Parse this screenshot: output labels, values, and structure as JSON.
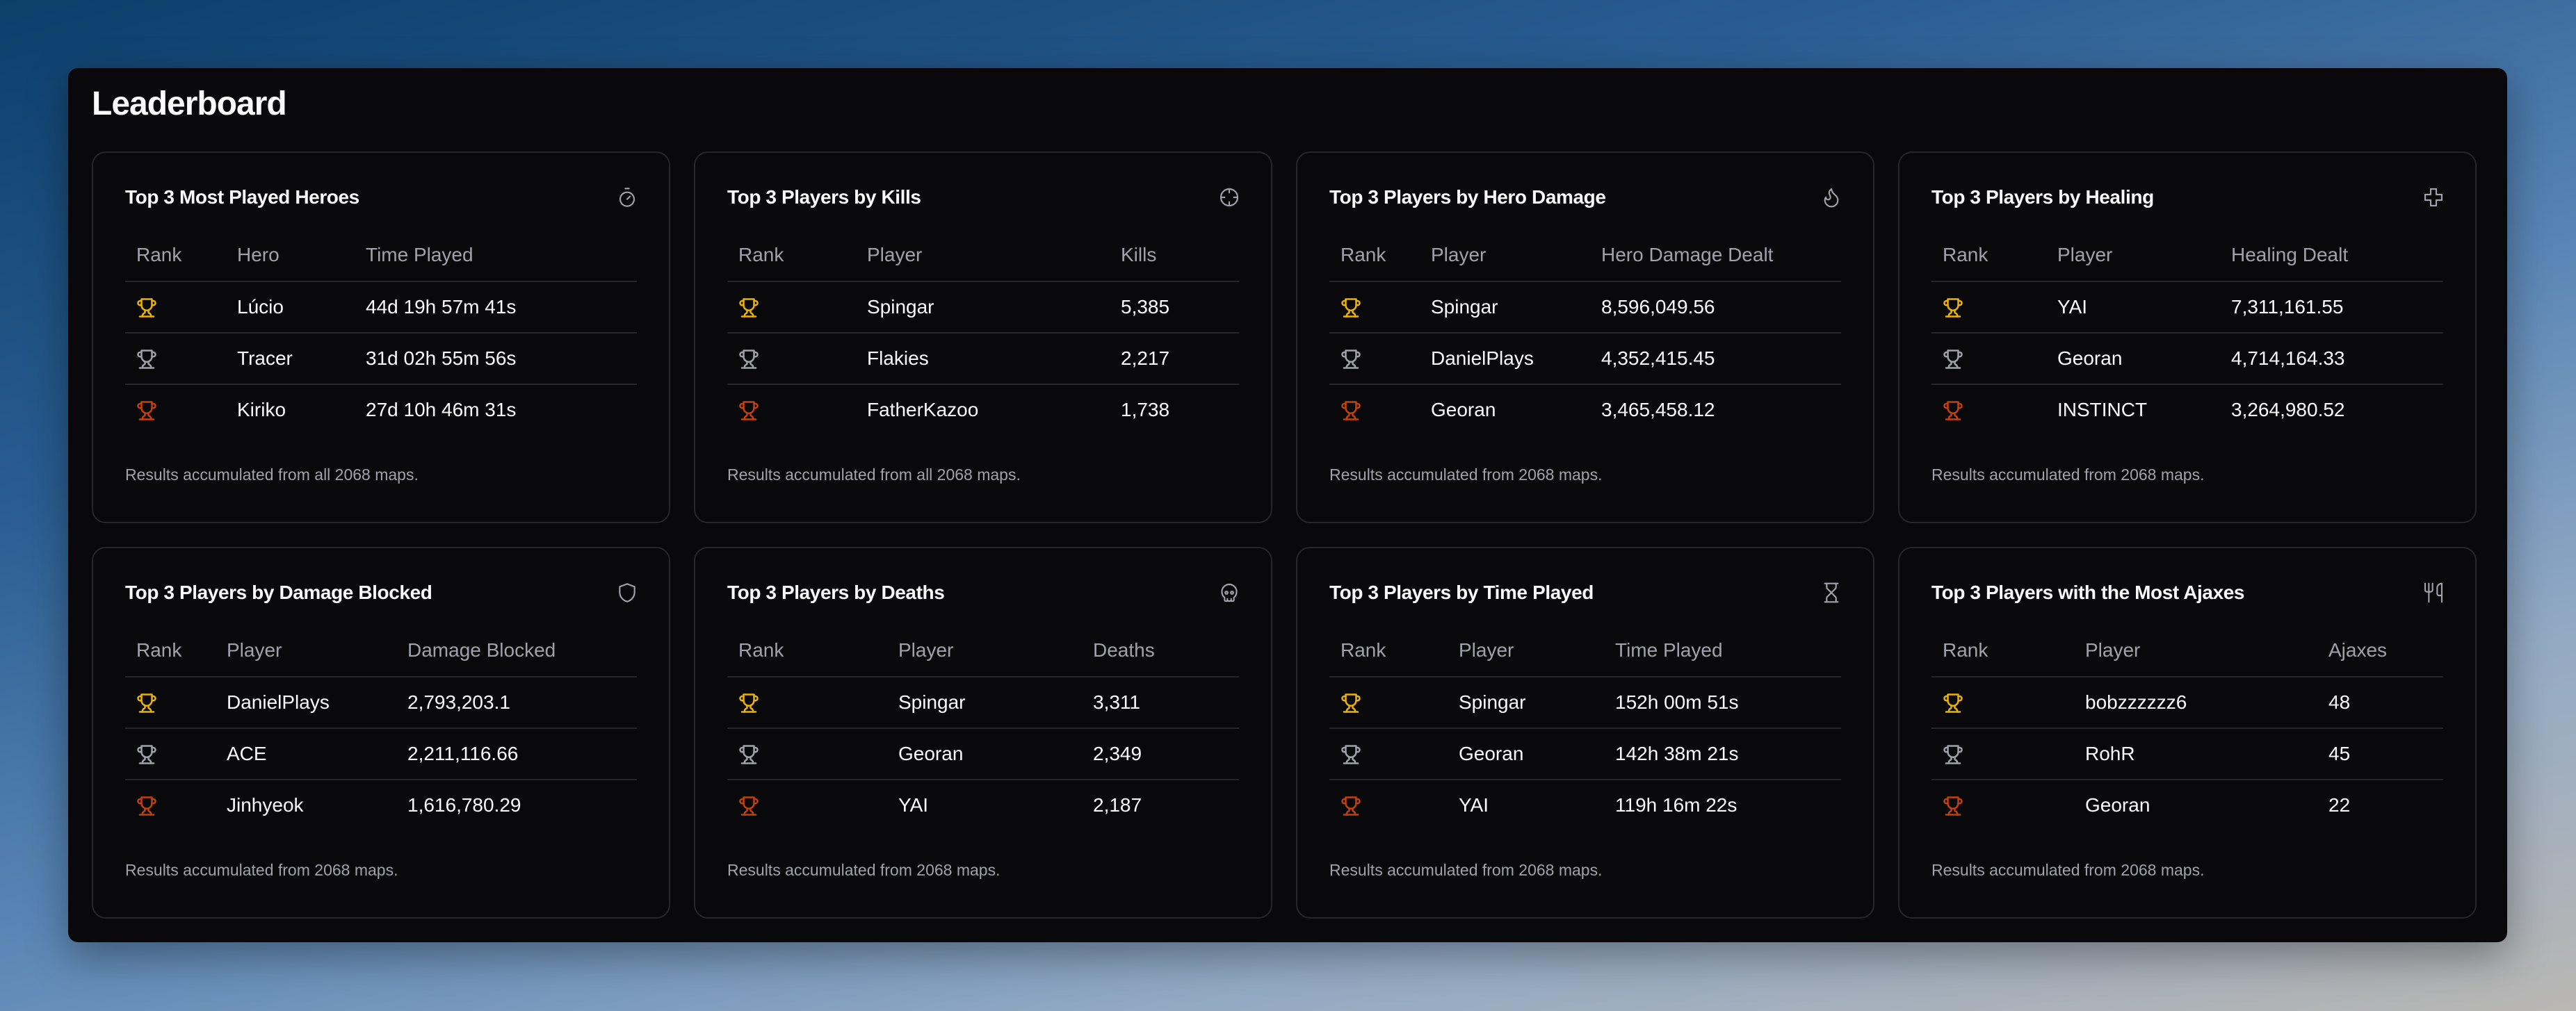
{
  "page": {
    "title": "Leaderboard"
  },
  "colors": {
    "gold": "#eab308",
    "silver": "#a1a1aa",
    "bronze": "#c2410c"
  },
  "cards": [
    {
      "title": "Top 3 Most Played Heroes",
      "icon": "timer-icon",
      "headers": [
        "Rank",
        "Hero",
        "Time Played"
      ],
      "rows": [
        {
          "rank": "gold",
          "name": "Lúcio",
          "value": "44d 19h 57m 41s"
        },
        {
          "rank": "silver",
          "name": "Tracer",
          "value": "31d 02h 55m 56s"
        },
        {
          "rank": "bronze",
          "name": "Kiriko",
          "value": "27d 10h 46m 31s"
        }
      ],
      "footer": "Results accumulated from all 2068 maps."
    },
    {
      "title": "Top 3 Players by Kills",
      "icon": "crosshair-icon",
      "headers": [
        "Rank",
        "Player",
        "Kills"
      ],
      "rows": [
        {
          "rank": "gold",
          "name": "Spingar",
          "value": "5,385"
        },
        {
          "rank": "silver",
          "name": "Flakies",
          "value": "2,217"
        },
        {
          "rank": "bronze",
          "name": "FatherKazoo",
          "value": "1,738"
        }
      ],
      "footer": "Results accumulated from all 2068 maps."
    },
    {
      "title": "Top 3 Players by Hero Damage",
      "icon": "flame-icon",
      "headers": [
        "Rank",
        "Player",
        "Hero Damage Dealt"
      ],
      "rows": [
        {
          "rank": "gold",
          "name": "Spingar",
          "value": "8,596,049.56"
        },
        {
          "rank": "silver",
          "name": "DanielPlays",
          "value": "4,352,415.45"
        },
        {
          "rank": "bronze",
          "name": "Georan",
          "value": "3,465,458.12"
        }
      ],
      "footer": "Results accumulated from 2068 maps."
    },
    {
      "title": "Top 3 Players by Healing",
      "icon": "plus-icon",
      "headers": [
        "Rank",
        "Player",
        "Healing Dealt"
      ],
      "rows": [
        {
          "rank": "gold",
          "name": "YAI",
          "value": "7,311,161.55"
        },
        {
          "rank": "silver",
          "name": "Georan",
          "value": "4,714,164.33"
        },
        {
          "rank": "bronze",
          "name": "INSTINCT",
          "value": "3,264,980.52"
        }
      ],
      "footer": "Results accumulated from 2068 maps."
    },
    {
      "title": "Top 3 Players by Damage Blocked",
      "icon": "shield-icon",
      "headers": [
        "Rank",
        "Player",
        "Damage Blocked"
      ],
      "rows": [
        {
          "rank": "gold",
          "name": "DanielPlays",
          "value": "2,793,203.1"
        },
        {
          "rank": "silver",
          "name": "ACE",
          "value": "2,211,116.66"
        },
        {
          "rank": "bronze",
          "name": "Jinhyeok",
          "value": "1,616,780.29"
        }
      ],
      "footer": "Results accumulated from 2068 maps."
    },
    {
      "title": "Top 3 Players by Deaths",
      "icon": "skull-icon",
      "headers": [
        "Rank",
        "Player",
        "Deaths"
      ],
      "rows": [
        {
          "rank": "gold",
          "name": "Spingar",
          "value": "3,311"
        },
        {
          "rank": "silver",
          "name": "Georan",
          "value": "2,349"
        },
        {
          "rank": "bronze",
          "name": "YAI",
          "value": "2,187"
        }
      ],
      "footer": "Results accumulated from 2068 maps."
    },
    {
      "title": "Top 3 Players by Time Played",
      "icon": "hourglass-icon",
      "headers": [
        "Rank",
        "Player",
        "Time Played"
      ],
      "rows": [
        {
          "rank": "gold",
          "name": "Spingar",
          "value": "152h 00m 51s"
        },
        {
          "rank": "silver",
          "name": "Georan",
          "value": "142h 38m 21s"
        },
        {
          "rank": "bronze",
          "name": "YAI",
          "value": "119h 16m 22s"
        }
      ],
      "footer": "Results accumulated from 2068 maps."
    },
    {
      "title": "Top 3 Players with the Most Ajaxes",
      "icon": "utensils-icon",
      "headers": [
        "Rank",
        "Player",
        "Ajaxes"
      ],
      "rows": [
        {
          "rank": "gold",
          "name": "bobzzzzzz6",
          "value": "48"
        },
        {
          "rank": "silver",
          "name": "RohR",
          "value": "45"
        },
        {
          "rank": "bronze",
          "name": "Georan",
          "value": "22"
        }
      ],
      "footer": "Results accumulated from 2068 maps."
    }
  ]
}
